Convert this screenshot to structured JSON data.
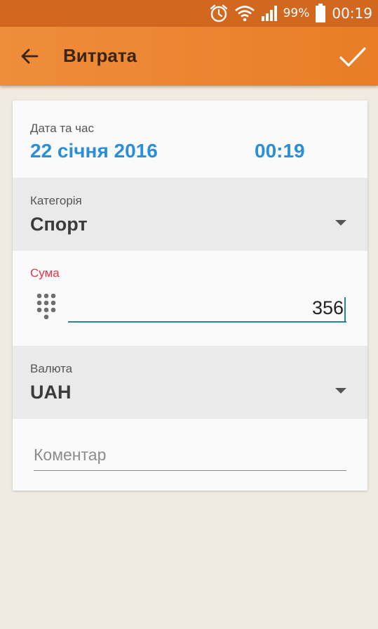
{
  "status_bar": {
    "battery_percent": "99%",
    "time": "00:19",
    "icons": [
      "alarm-icon",
      "wifi-icon",
      "signal-icon",
      "battery-icon"
    ]
  },
  "app_bar": {
    "title": "Витрата",
    "back_icon": "back-arrow-icon",
    "confirm_icon": "checkmark-icon"
  },
  "form": {
    "date": {
      "label": "Дата та час",
      "date_value": "22 січня 2016",
      "time_value": "00:19"
    },
    "category": {
      "label": "Категорія",
      "value": "Спорт"
    },
    "amount": {
      "label": "Сума",
      "value": "356",
      "icon": "keypad-icon"
    },
    "currency": {
      "label": "Валюта",
      "value": "UAH"
    },
    "comment": {
      "placeholder": "Коментар",
      "value": ""
    }
  },
  "colors": {
    "status_bar": "#d2671f",
    "app_bar": "#ec8632",
    "accent_blue": "#2a8ed9",
    "label_red": "#e2344a",
    "input_underline": "#1d8a96",
    "background": "#efebe2"
  }
}
